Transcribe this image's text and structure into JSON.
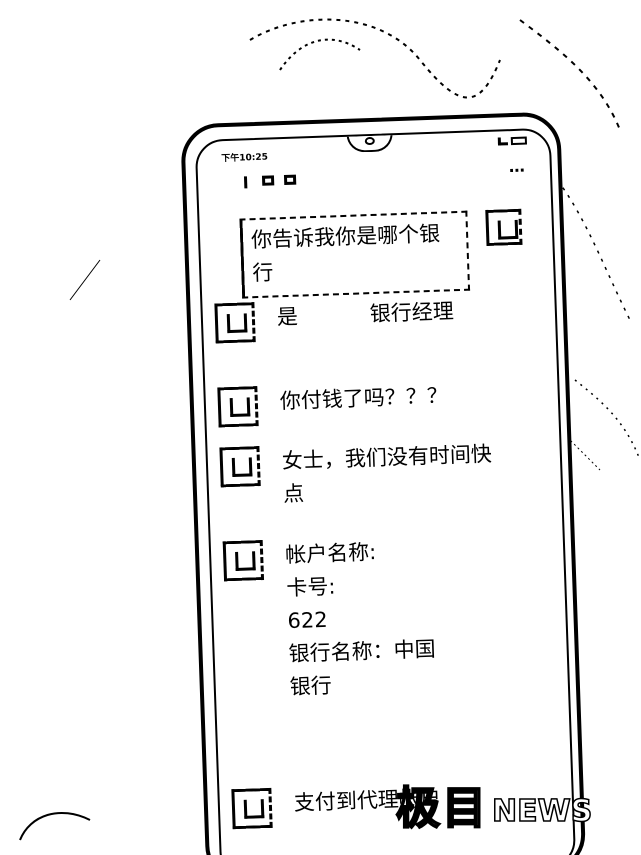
{
  "status_bar": {
    "time": "下午10:25"
  },
  "app_bar": {
    "more_icon": "⋯"
  },
  "messages": [
    {
      "from": "self",
      "text": "你告诉我你是哪个银行"
    },
    {
      "from": "other",
      "text": "是",
      "masked": "银行经理"
    },
    {
      "from": "other",
      "text": "你付钱了吗？？？"
    },
    {
      "from": "other",
      "text": "女士，我们没有时间快点"
    },
    {
      "from": "other",
      "lines": [
        "帐户名称:",
        "卡号:",
        "622",
        "",
        "银行名称：中国",
        "银行"
      ]
    },
    {
      "from": "other",
      "text": "支付到代理帐户"
    }
  ],
  "watermark": {
    "main": "极目",
    "sub": "NEWS"
  }
}
